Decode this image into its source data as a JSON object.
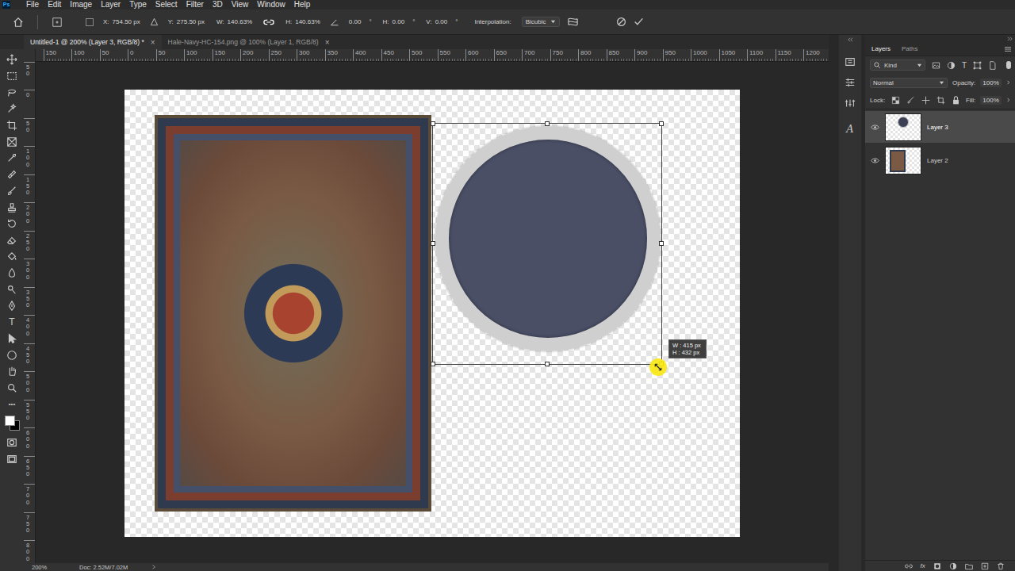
{
  "window": {
    "app_logo": "Ps"
  },
  "menu": [
    "File",
    "Edit",
    "Image",
    "Layer",
    "Type",
    "Select",
    "Filter",
    "3D",
    "View",
    "Window",
    "Help"
  ],
  "options_bar": {
    "x_label": "X:",
    "x": "754.50 px",
    "y_label": "Y:",
    "y": "275.50 px",
    "w_label": "W:",
    "w": "140.63%",
    "link_on": true,
    "h_label": "H:",
    "h": "140.63%",
    "angle": "0.00",
    "angle_unit": "°",
    "hskew_label": "H:",
    "hskew": "0.00",
    "hskew_unit": "°",
    "vskew_label": "V:",
    "vskew": "0.00",
    "vskew_unit": "°",
    "interpolation_label": "Interpolation:",
    "interpolation": "Bicubic"
  },
  "tabs": [
    {
      "label": "Untitled-1 @ 200% (Layer 3, RGB/8) *",
      "close": "×",
      "selected": true
    },
    {
      "label": "Hale-Navy-HC-154.png @ 100% (Layer 1, RGB/8)",
      "close": "×",
      "selected": false
    }
  ],
  "rulers": {
    "horizontal": [
      "150",
      "100",
      "50",
      "0",
      "50",
      "100",
      "150",
      "200",
      "250",
      "300",
      "350",
      "400",
      "450",
      "500",
      "550",
      "600",
      "650",
      "700",
      "750",
      "800",
      "850",
      "900",
      "950",
      "1000",
      "1050",
      "1100",
      "1150",
      "1200"
    ],
    "vertical": [
      "50",
      "0",
      "50",
      "100",
      "150",
      "200",
      "250",
      "300",
      "350",
      "400",
      "450",
      "500",
      "550",
      "600",
      "650",
      "700",
      "750",
      "800"
    ]
  },
  "tools_text": {
    "type": "T",
    "more": "•••"
  },
  "transform_tooltip": {
    "w": "W : 415 px",
    "h": "H : 432 px"
  },
  "dock_icons_text": {
    "character": "A"
  },
  "layers_panel": {
    "tabs": [
      {
        "label": "Layers",
        "selected": true
      },
      {
        "label": "Paths",
        "selected": false
      }
    ],
    "filter": "Kind",
    "filter_type": "T",
    "blend_mode": "Normal",
    "opacity_label": "Opacity:",
    "opacity": "100%",
    "lock_label": "Lock:",
    "fill_label": "Fill:",
    "fill": "100%",
    "layers": [
      {
        "name": "Layer 3",
        "visible": true,
        "selected": true,
        "kind": "circle"
      },
      {
        "name": "Layer 2",
        "visible": true,
        "selected": false,
        "kind": "rug"
      }
    ],
    "footer_fx": "fx"
  },
  "status_bar": {
    "zoom": "200%",
    "doc": "Doc: 2.52M/7.02M"
  }
}
